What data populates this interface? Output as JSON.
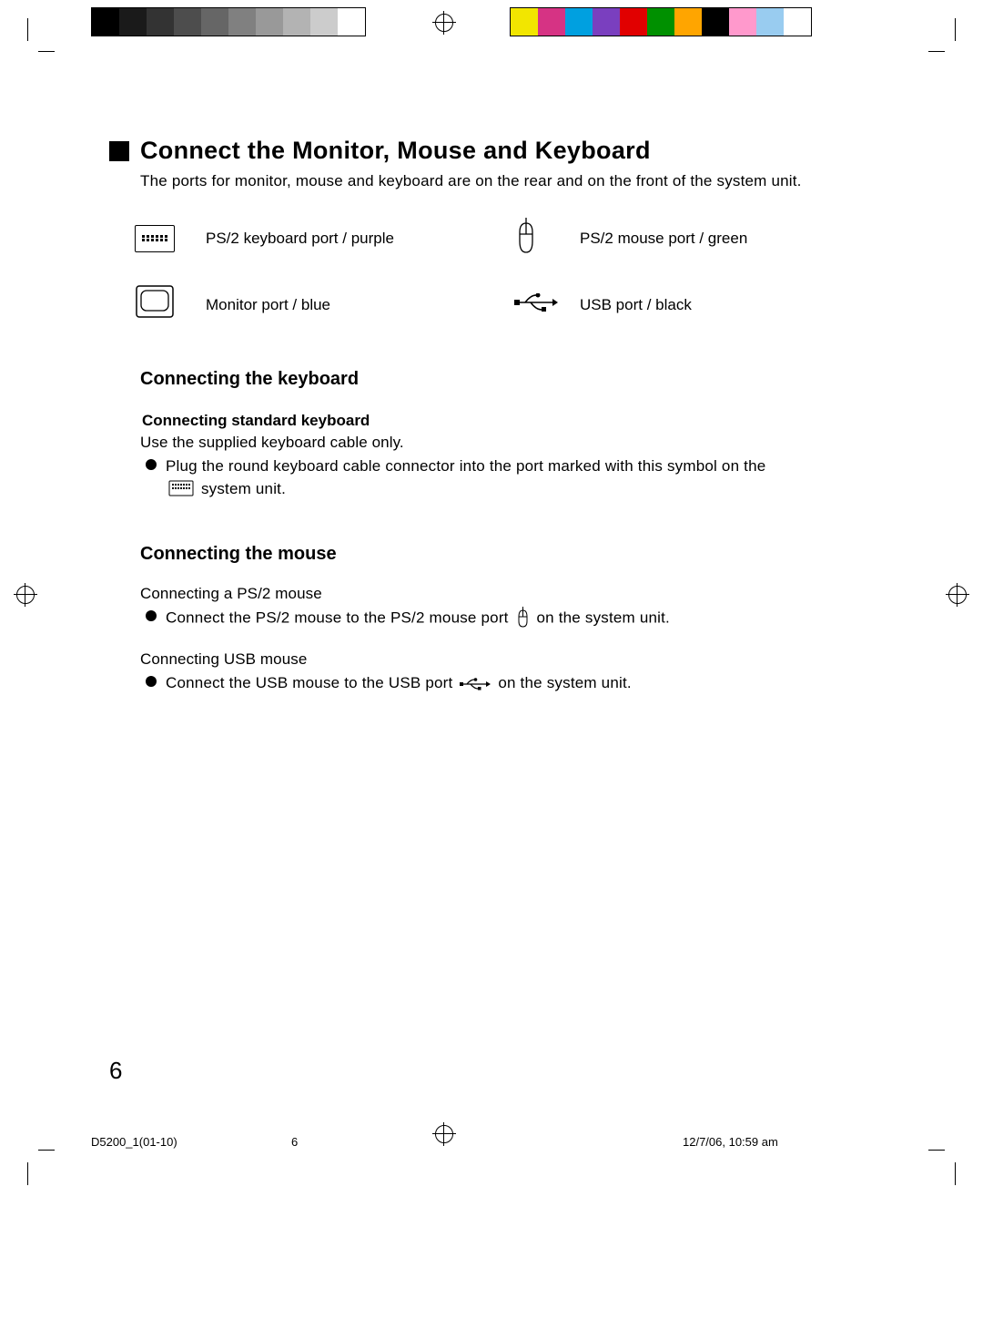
{
  "heading": "Connect the Monitor, Mouse and Keyboard",
  "intro": "The ports for monitor, mouse and keyboard are on the rear and on the front of the system unit.",
  "ports": {
    "keyboard": "PS/2 keyboard port / purple",
    "mouse": "PS/2 mouse port / green",
    "monitor": "Monitor port / blue",
    "usb": "USB port / black"
  },
  "section_keyboard": {
    "title": "Connecting the keyboard",
    "sub": "Connecting standard keyboard",
    "line1": "Use the supplied keyboard cable only.",
    "bullet_a": "Plug the round keyboard cable connector into the port marked with this symbol on the",
    "bullet_b": "system unit."
  },
  "section_mouse": {
    "title": "Connecting the mouse",
    "ps2_label": "Connecting a PS/2 mouse",
    "ps2_bullet_a": "Connect the PS/2 mouse to the PS/2 mouse port",
    "ps2_bullet_b": "on the system unit.",
    "usb_label": "Connecting USB mouse",
    "usb_bullet_a": "Connect the USB mouse to the USB port",
    "usb_bullet_b": "on the system unit."
  },
  "page_number": "6",
  "footer": {
    "file": "D5200_1(01-10)",
    "page": "6",
    "datetime": "12/7/06, 10:59 am"
  },
  "gray_swatches": [
    "#000000",
    "#1a1a1a",
    "#333333",
    "#4d4d4d",
    "#666666",
    "#808080",
    "#999999",
    "#b3b3b3",
    "#cccccc",
    "#ffffff"
  ],
  "color_swatches": [
    "#f2e600",
    "#d63384",
    "#00a0e0",
    "#7a3fbf",
    "#e10000",
    "#009000",
    "#ffa500",
    "#000000",
    "#ff99cc",
    "#99ccf0",
    "#ffffff"
  ]
}
